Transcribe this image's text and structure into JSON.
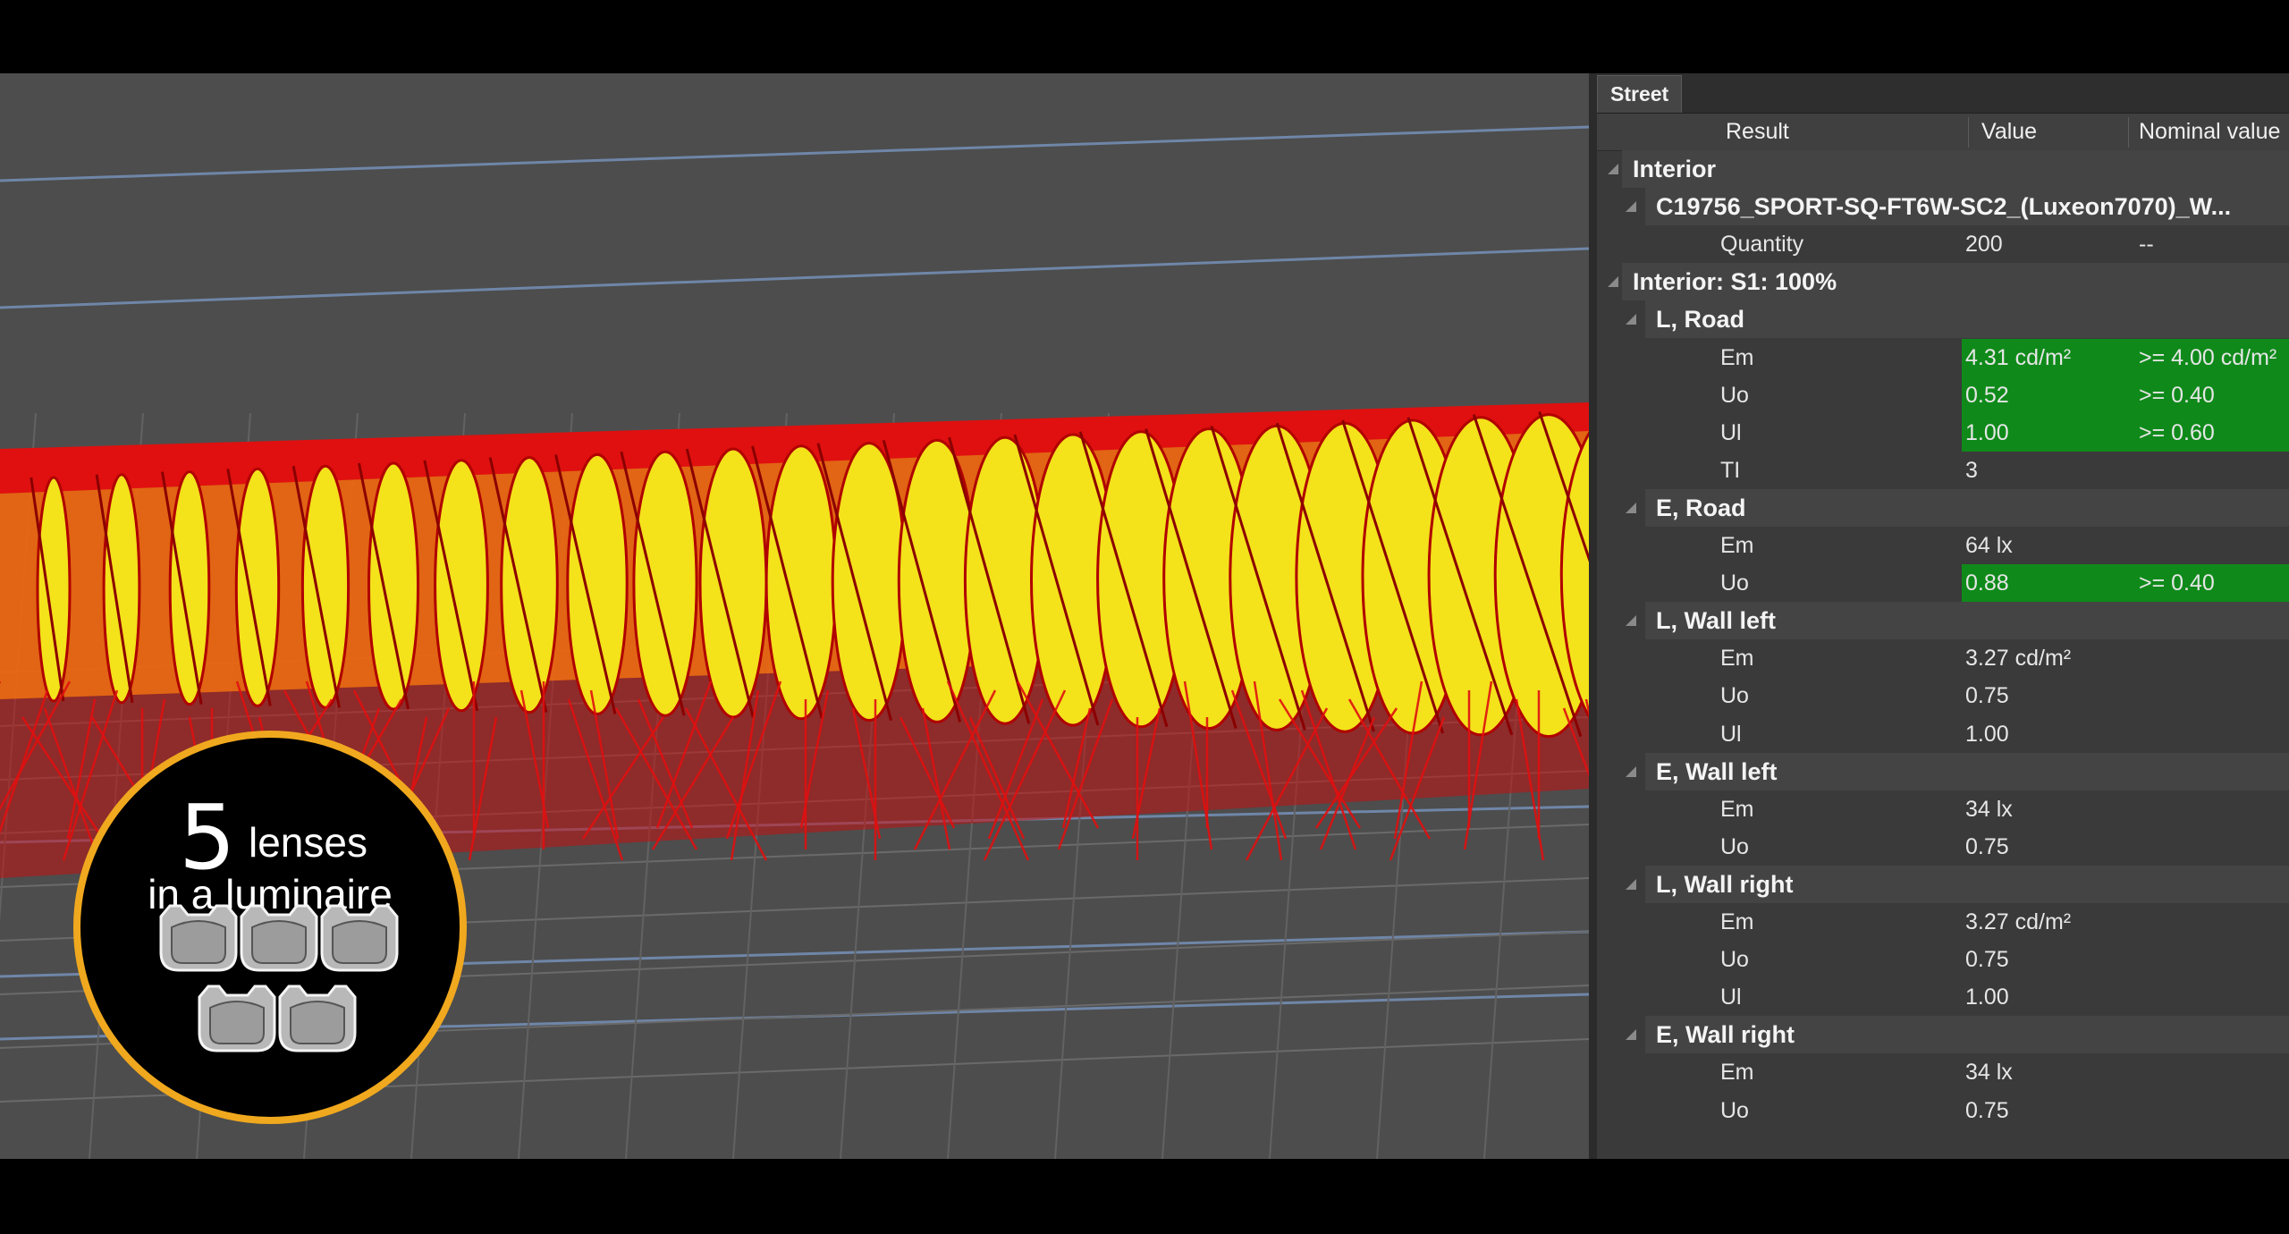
{
  "panel": {
    "tab_label": "Street",
    "columns": {
      "result": "Result",
      "value": "Value",
      "nominal": "Nominal value"
    },
    "rows": [
      {
        "level": 0,
        "type": "group",
        "label": "Interior",
        "value": "",
        "nominal": "",
        "ok": false
      },
      {
        "level": 1,
        "type": "group",
        "label": "C19756_SPORT-SQ-FT6W-SC2_(Luxeon7070)_W...",
        "value": "",
        "nominal": "",
        "ok": false
      },
      {
        "level": 2,
        "type": "item",
        "label": "Quantity",
        "value": "200",
        "nominal": "--",
        "ok": false
      },
      {
        "level": 0,
        "type": "group",
        "label": "Interior: S1: 100%",
        "value": "",
        "nominal": "",
        "ok": false
      },
      {
        "level": 1,
        "type": "group",
        "label": "L, Road",
        "value": "",
        "nominal": "",
        "ok": false
      },
      {
        "level": 2,
        "type": "item",
        "label": "Em",
        "value": "4.31 cd/m²",
        "nominal": ">= 4.00 cd/m²",
        "ok": true
      },
      {
        "level": 2,
        "type": "item",
        "label": "Uo",
        "value": "0.52",
        "nominal": ">= 0.40",
        "ok": true
      },
      {
        "level": 2,
        "type": "item",
        "label": "Ul",
        "value": "1.00",
        "nominal": ">= 0.60",
        "ok": true
      },
      {
        "level": 2,
        "type": "item",
        "label": "TI",
        "value": "3",
        "nominal": "",
        "ok": false
      },
      {
        "level": 1,
        "type": "group",
        "label": "E, Road",
        "value": "",
        "nominal": "",
        "ok": false
      },
      {
        "level": 2,
        "type": "item",
        "label": "Em",
        "value": "64 lx",
        "nominal": "",
        "ok": false
      },
      {
        "level": 2,
        "type": "item",
        "label": "Uo",
        "value": "0.88",
        "nominal": ">= 0.40",
        "ok": true
      },
      {
        "level": 1,
        "type": "group",
        "label": "L, Wall left",
        "value": "",
        "nominal": "",
        "ok": false
      },
      {
        "level": 2,
        "type": "item",
        "label": "Em",
        "value": "3.27 cd/m²",
        "nominal": "",
        "ok": false
      },
      {
        "level": 2,
        "type": "item",
        "label": "Uo",
        "value": "0.75",
        "nominal": "",
        "ok": false
      },
      {
        "level": 2,
        "type": "item",
        "label": "Ul",
        "value": "1.00",
        "nominal": "",
        "ok": false
      },
      {
        "level": 1,
        "type": "group",
        "label": "E, Wall left",
        "value": "",
        "nominal": "",
        "ok": false
      },
      {
        "level": 2,
        "type": "item",
        "label": "Em",
        "value": "34 lx",
        "nominal": "",
        "ok": false
      },
      {
        "level": 2,
        "type": "item",
        "label": "Uo",
        "value": "0.75",
        "nominal": "",
        "ok": false
      },
      {
        "level": 1,
        "type": "group",
        "label": "L, Wall right",
        "value": "",
        "nominal": "",
        "ok": false
      },
      {
        "level": 2,
        "type": "item",
        "label": "Em",
        "value": "3.27 cd/m²",
        "nominal": "",
        "ok": false
      },
      {
        "level": 2,
        "type": "item",
        "label": "Uo",
        "value": "0.75",
        "nominal": "",
        "ok": false
      },
      {
        "level": 2,
        "type": "item",
        "label": "Ul",
        "value": "1.00",
        "nominal": "",
        "ok": false
      },
      {
        "level": 1,
        "type": "group",
        "label": "E, Wall right",
        "value": "",
        "nominal": "",
        "ok": false
      },
      {
        "level": 2,
        "type": "item",
        "label": "Em",
        "value": "34 lx",
        "nominal": "",
        "ok": false
      },
      {
        "level": 2,
        "type": "item",
        "label": "Uo",
        "value": "0.75",
        "nominal": "",
        "ok": false
      }
    ]
  },
  "badge": {
    "number": "5",
    "word": "lenses",
    "subtitle": "in a luminaire",
    "lens_icon_count": 5
  },
  "colors": {
    "ok_green": "#0f8a1a",
    "badge_ring": "#f0a81e",
    "ray_red": "#e01010",
    "ray_orange": "#f07010",
    "ray_yellow": "#f4e21a"
  }
}
